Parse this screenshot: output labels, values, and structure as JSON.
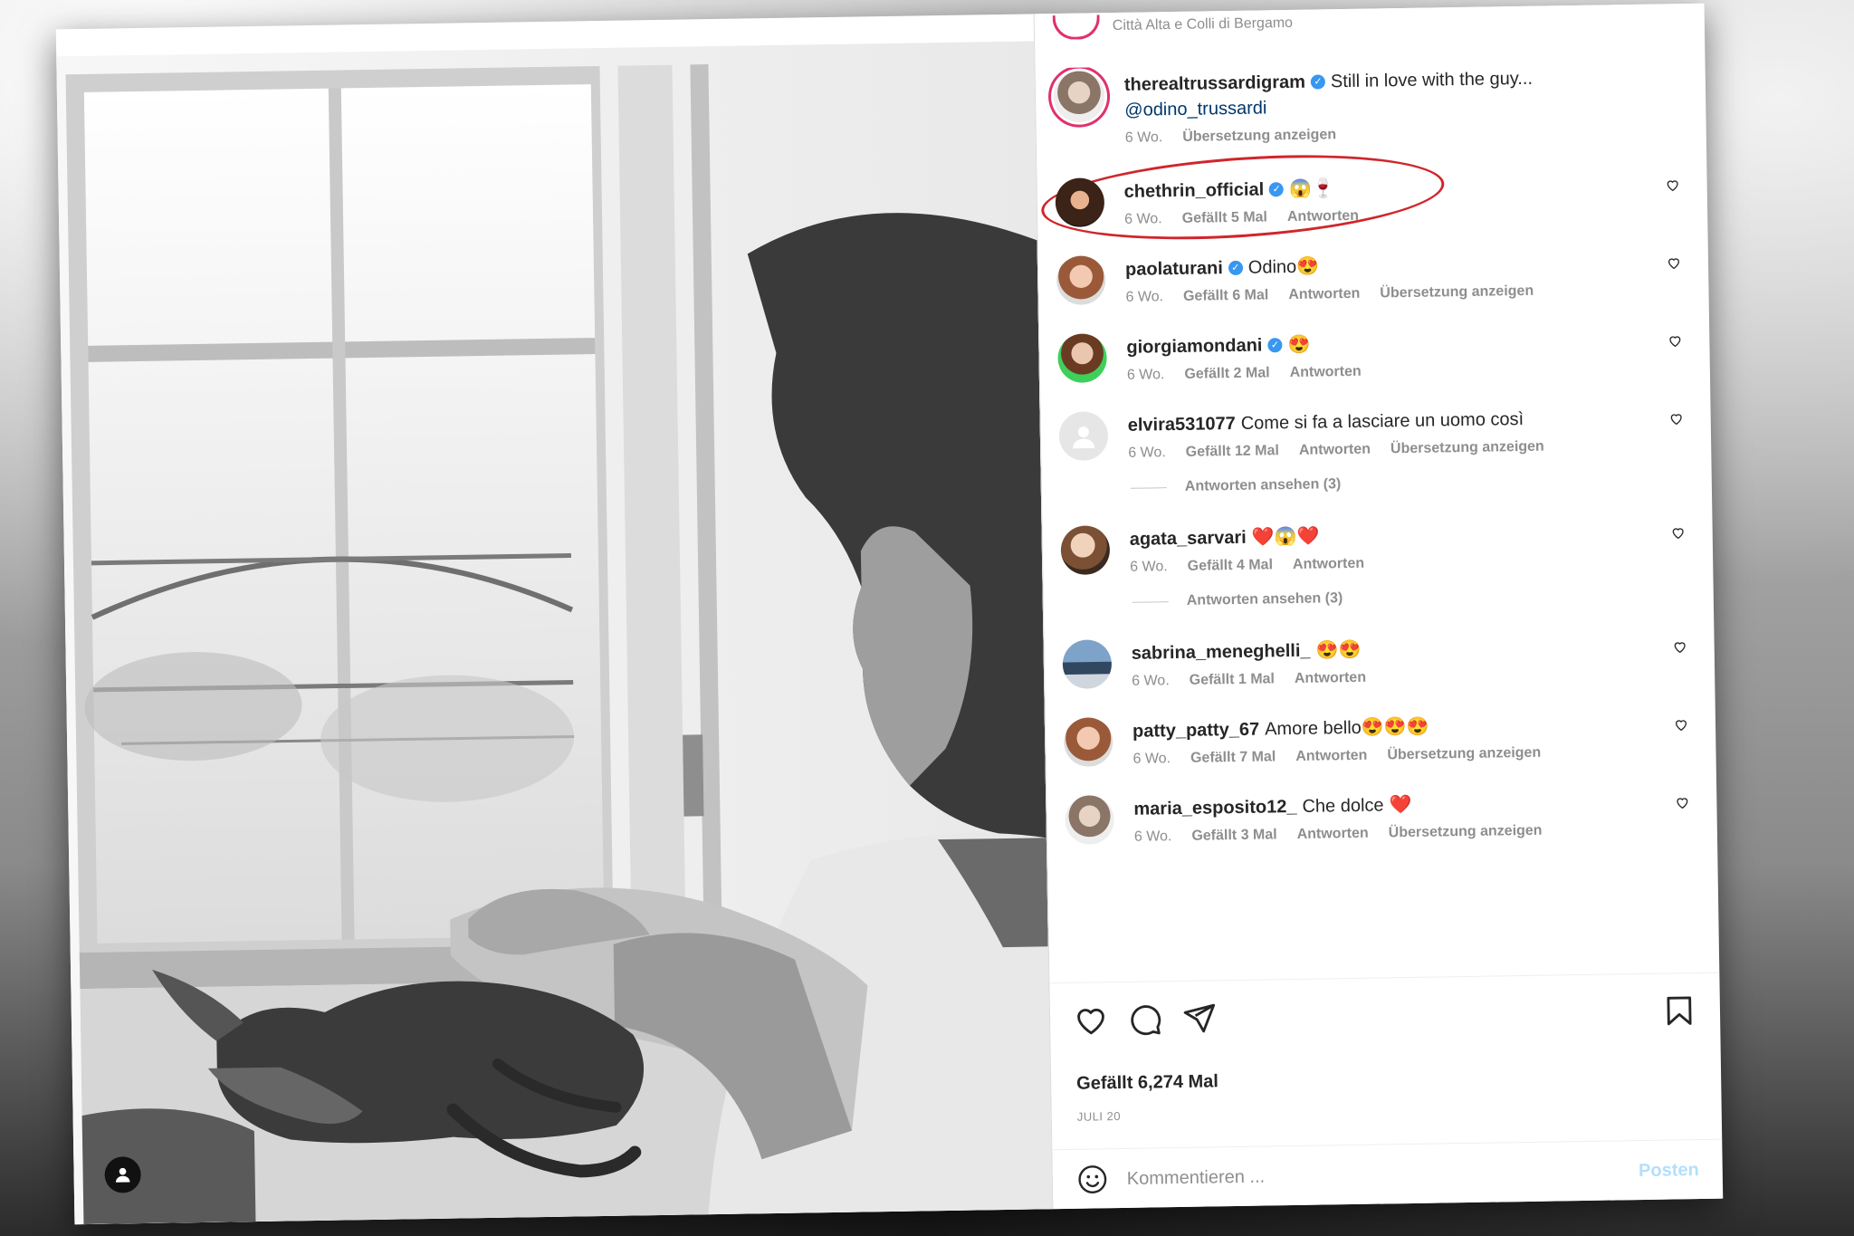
{
  "post": {
    "location": "Città Alta e Colli di Bergamo",
    "caption": {
      "username": "therealtrussardigram",
      "text": "Still in love with the guy...",
      "mention": "@odino_trussardi",
      "time": "6 Wo.",
      "translate": "Übersetzung anzeigen"
    }
  },
  "comments": [
    {
      "username": "chethrin_official",
      "verified": true,
      "text": "",
      "emoji": "😱🍷",
      "time": "6 Wo.",
      "likes": "Gefällt 5 Mal",
      "reply": "Antworten",
      "translate": "",
      "highlighted": true
    },
    {
      "username": "paolaturani",
      "verified": true,
      "text": "Odino",
      "emoji": "😍",
      "time": "6 Wo.",
      "likes": "Gefällt 6 Mal",
      "reply": "Antworten",
      "translate": "Übersetzung anzeigen"
    },
    {
      "username": "giorgiamondani",
      "verified": true,
      "text": "",
      "emoji": "😍",
      "time": "6 Wo.",
      "likes": "Gefällt 2 Mal",
      "reply": "Antworten",
      "translate": ""
    },
    {
      "username": "elvira531077",
      "verified": false,
      "text": "Come si fa a lasciare un uomo così",
      "emoji": "",
      "time": "6 Wo.",
      "likes": "Gefällt 12 Mal",
      "reply": "Antworten",
      "translate": "Übersetzung anzeigen",
      "view_replies": "Antworten ansehen (3)"
    },
    {
      "username": "agata_sarvari",
      "verified": false,
      "text": "",
      "emoji": "❤️😱❤️",
      "time": "6 Wo.",
      "likes": "Gefällt 4 Mal",
      "reply": "Antworten",
      "translate": "",
      "view_replies": "Antworten ansehen (3)"
    },
    {
      "username": "sabrina_meneghelli_",
      "verified": false,
      "text": "",
      "emoji": "😍😍",
      "time": "6 Wo.",
      "likes": "Gefällt 1 Mal",
      "reply": "Antworten",
      "translate": ""
    },
    {
      "username": "patty_patty_67",
      "verified": false,
      "text": "Amore bello",
      "emoji": "😍😍😍",
      "time": "6 Wo.",
      "likes": "Gefällt 7 Mal",
      "reply": "Antworten",
      "translate": "Übersetzung anzeigen"
    },
    {
      "username": "maria_esposito12_",
      "verified": false,
      "text": "Che dolce",
      "emoji": "❤️",
      "time": "6 Wo.",
      "likes": "Gefällt 3 Mal",
      "reply": "Antworten",
      "translate": "Übersetzung anzeigen"
    }
  ],
  "actions": {
    "likes_label": "Gefällt 6,274 Mal",
    "date": "JULI 20",
    "icons": [
      "heart-icon",
      "comment-icon",
      "share-icon",
      "bookmark-icon"
    ]
  },
  "composer": {
    "placeholder": "Kommentieren ...",
    "post_label": "Posten"
  },
  "colors": {
    "accent": "#3897f0",
    "highlight_circle": "#d0252b",
    "story_ring": "#e1306c",
    "post_button_disabled": "#b2dffc"
  }
}
